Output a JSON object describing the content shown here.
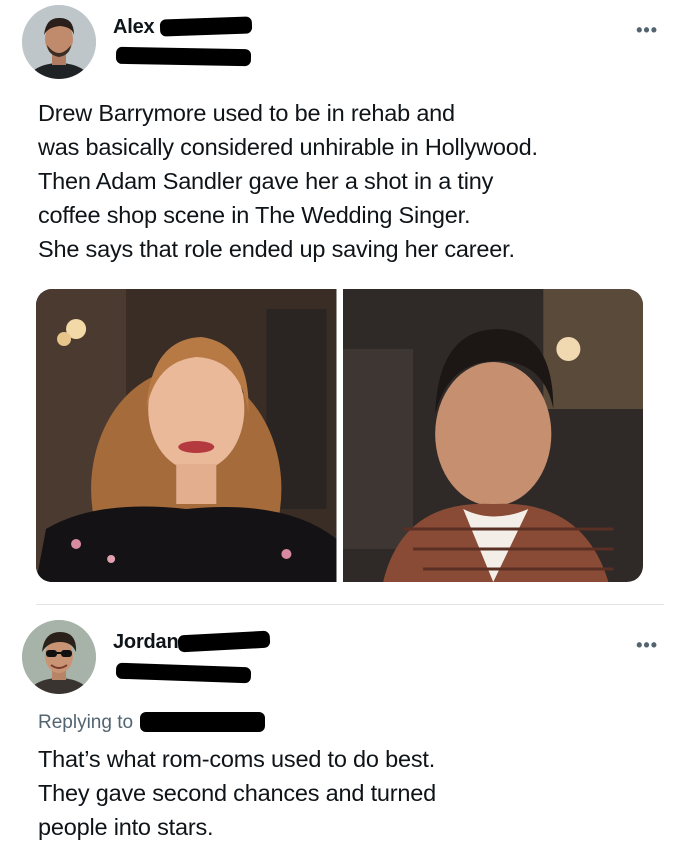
{
  "tweet1": {
    "display_name": "Alex",
    "more_label": "•••",
    "lines": [
      "Drew Barrymore used to be in rehab and",
      "was basically considered unhirable in Hollywood.",
      "Then Adam Sandler gave her a shot in a tiny",
      "coffee shop scene in The Wedding Singer.",
      "She says that role ended up saving her career."
    ]
  },
  "tweet2": {
    "display_name": "Jordan",
    "more_label": "•••",
    "replying_label": "Replying to",
    "lines": [
      "That’s what rom-coms used to do best.",
      "They gave second chances and turned",
      "people into stars."
    ]
  },
  "colors": {
    "text": "#0f1419",
    "secondary": "#536471",
    "link": "#1d9bf0",
    "divider": "#e1e5e8",
    "redaction": "#000000"
  }
}
